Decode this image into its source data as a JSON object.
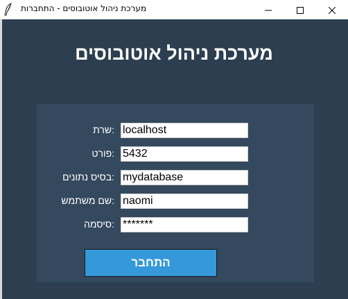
{
  "window": {
    "title": "מערכת ניהול אוטובוסים - התחברות"
  },
  "heading": "מערכת ניהול אוטובוסים",
  "form": {
    "fields": [
      {
        "label": ":שרת",
        "value": "localhost"
      },
      {
        "label": ":פורט",
        "value": "5432"
      },
      {
        "label": ":בסיס נתונים",
        "value": "mydatabase"
      },
      {
        "label": ":שם משתמש",
        "value": "naomi"
      },
      {
        "label": ":סיסמה",
        "value": "*******"
      }
    ],
    "connect_label": "התחבר"
  },
  "colors": {
    "background": "#2c3e50",
    "panel": "#34495e",
    "button": "#3498db"
  },
  "icons": {
    "app": "feather-icon",
    "minimize": "minimize-icon",
    "maximize": "maximize-icon",
    "close": "close-icon"
  }
}
